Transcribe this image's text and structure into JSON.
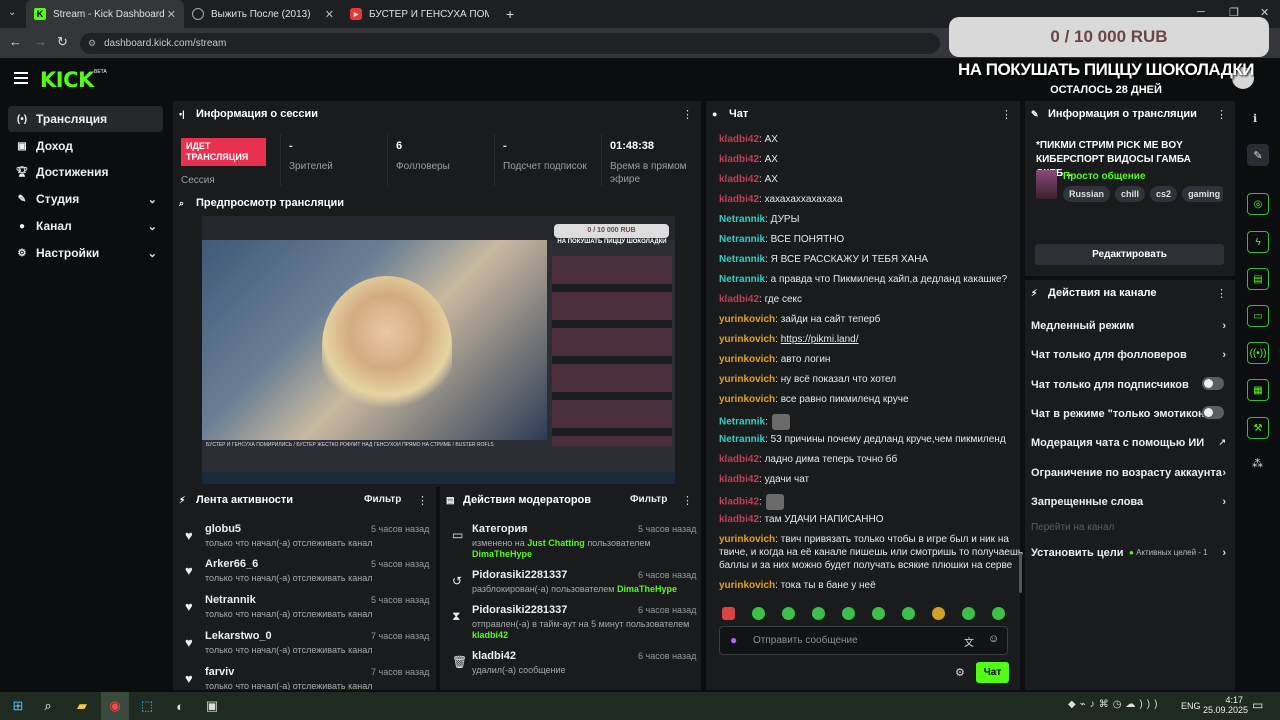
{
  "browser": {
    "tabs": [
      {
        "label": "Stream - Kick Dashboard",
        "active": true
      },
      {
        "label": "Выжить После (2013)",
        "active": false
      },
      {
        "label": "БУСТЕР И ГЕНСУХА ПОМИРИЛ...",
        "active": false
      }
    ],
    "new_tab": "+",
    "url": "dashboard.kick.com/stream"
  },
  "overlay": {
    "goal": "0 / 10 000 RUB",
    "title": "НА ПОКУШАТЬ ПИЦЦУ ШОКОЛАДКИ",
    "subtitle": "ОСТАЛОСЬ 28 ДНЕЙ"
  },
  "header": {
    "logo": "KICK",
    "beta": "BETA"
  },
  "sidebar": {
    "items": [
      {
        "label": "Трансляция",
        "icon": "broadcast-icon"
      },
      {
        "label": "Доход",
        "icon": "wallet-icon"
      },
      {
        "label": "Достижения",
        "icon": "trophy-icon"
      },
      {
        "label": "Студия",
        "icon": "brush-icon"
      },
      {
        "label": "Канал",
        "icon": "person-icon"
      },
      {
        "label": "Настройки",
        "icon": "gear-icon"
      }
    ]
  },
  "session": {
    "title": "Информация о сессии",
    "live_badge": "ИДЕТ ТРАНСЛЯЦИЯ",
    "session_label": "Сессия",
    "stats": [
      {
        "value": "-",
        "label": "Зрителей"
      },
      {
        "value": "6",
        "label": "Фолловеры"
      },
      {
        "value": "-",
        "label": "Подсчет подписок"
      },
      {
        "value": "01:48:38",
        "label": "Время в прямом эфире"
      }
    ]
  },
  "preview": {
    "title": "Предпросмотр трансляции",
    "inner_goal": "0 / 10 000 RUB",
    "inner_title": "НА ПОКУШАТЬ ПИЦЦУ ШОКОЛАДКИ",
    "inner_video_title": "БУСТЕР И ГЕНСУХА ПОМИРИЛИСЬ / БУСТЕР ЖЕСТКО РОФЛИТ НАД ГЕНСУХОЙ ПРЯМО НА СТРИМЕ / BUSTER ROFLS"
  },
  "activity": {
    "title": "Лента активности",
    "filter": "Фильтр",
    "items": [
      {
        "name": "globu5",
        "text": "только что начал(-а) отслеживать канал",
        "time": "5 часов назад"
      },
      {
        "name": "Arker66_6",
        "text": "только что начал(-а) отслеживать канал",
        "time": "5 часов назад"
      },
      {
        "name": "Netrannik",
        "text": "только что начал(-а) отслеживать канал",
        "time": "5 часов назад"
      },
      {
        "name": "Lekarstwo_0",
        "text": "только что начал(-а) отслеживать канал",
        "time": "7 часов назад"
      },
      {
        "name": "farviv",
        "text": "только что начал(-а) отслеживать канал",
        "time": "7 часов назад"
      }
    ]
  },
  "modactions": {
    "title": "Действия модераторов",
    "filter": "Фильтр",
    "items": [
      {
        "name": "Категория",
        "line1": "изменено на",
        "hl1": "Just Chatting",
        "line1b": "пользователем",
        "hl2": "DimaTheHype",
        "time": "5 часов назад",
        "icon": "category-icon"
      },
      {
        "name": "Pidorasiki2281337",
        "line1": "разблокирован(-а) пользователем",
        "hl1": "DimaTheHype",
        "time": "6 часов назад",
        "icon": "unban-icon"
      },
      {
        "name": "Pidorasiki2281337",
        "line1": "отправлен(-а) в тайм-аут на 5 минут пользователем",
        "hl1": "kladbi42",
        "time": "6 часов назад",
        "icon": "hourglass-icon"
      },
      {
        "name": "kladbi42",
        "line1": "удалил(-а) сообщение",
        "time": "6 часов назад",
        "icon": "trash-icon"
      }
    ]
  },
  "chat": {
    "title": "Чат",
    "messages": [
      {
        "user": "kladbi42",
        "color": "red",
        "text": ": АХ"
      },
      {
        "user": "kladbi42",
        "color": "red",
        "text": ": АХ"
      },
      {
        "user": "kladbi42",
        "color": "red",
        "text": ": АХ"
      },
      {
        "user": "kladbi42",
        "color": "red",
        "text": ": хахахаххахахаха"
      },
      {
        "user": "Netrannik",
        "color": "teal",
        "text": ": ДУРЫ"
      },
      {
        "user": "Netrannik",
        "color": "teal",
        "text": ": ВСЕ ПОНЯТНО"
      },
      {
        "user": "Netrannik",
        "color": "teal",
        "text": ": Я ВСЕ РАССКАЖУ И ТЕБЯ ХАНА"
      },
      {
        "user": "Netrannik",
        "color": "teal",
        "text": ": а правда что Пикмиленд хайп,а дедланд какашке?"
      },
      {
        "user": "kladbi42",
        "color": "red",
        "text": ": где секс"
      },
      {
        "user": "yurinkovich",
        "color": "gold",
        "text": ": зайди на сайт теперб"
      },
      {
        "user": "yurinkovich",
        "color": "gold",
        "text": ": ",
        "link": "https://pikmi.land/"
      },
      {
        "user": "yurinkovich",
        "color": "gold",
        "text": ": авто логин"
      },
      {
        "user": "yurinkovich",
        "color": "gold",
        "text": ": ну всё показал что хотел"
      },
      {
        "user": "yurinkovich",
        "color": "gold",
        "text": ": все равно пикмиленд круче"
      },
      {
        "user": "Netrannik",
        "color": "teal",
        "text": ":",
        "emote": true
      },
      {
        "user": "Netrannik",
        "color": "teal",
        "text": ": 53 причины почему дедланд круче,чем пикмиленд"
      },
      {
        "user": "kladbi42",
        "color": "red",
        "text": ": ладно дима теперь точно бб"
      },
      {
        "user": "kladbi42",
        "color": "red",
        "text": ": удачи чат"
      },
      {
        "user": "kladbi42",
        "color": "red",
        "text": ":",
        "emote": true
      },
      {
        "user": "kladbi42",
        "color": "red",
        "text": ": там УДАЧИ НАПИСАННО"
      },
      {
        "user": "yurinkovich",
        "color": "gold",
        "text": ": твич привязать только чтобы в игре был и ник на",
        "cont": [
          "твиче, и когда на её канале пишешь или смотришь то получаешь",
          "баллы и за них можно будет получать всякие плюшки на серве"
        ]
      },
      {
        "user": "yurinkovich",
        "color": "gold",
        "text": ": тока ты в бане у неё"
      }
    ],
    "input_placeholder": "Отправить сообщение",
    "send": "Чат"
  },
  "stream_info": {
    "title": "Информация о трансляции",
    "stream_title": "*ПИКМИ СТРИМ PICK ME BOY КИБЕРСПОРТ ВИДОСЫ ГАМБА СКЕБ...",
    "category": "Просто общение",
    "tags": [
      "Russian",
      "chill",
      "cs2",
      "gaming"
    ],
    "edit": "Редактировать"
  },
  "channel_actions": {
    "title": "Действия на канале",
    "items": [
      {
        "label": "Медленный режим",
        "kind": "chevron"
      },
      {
        "label": "Чат только для фолловеров",
        "kind": "chevron"
      },
      {
        "label": "Чат только для подписчиков",
        "kind": "toggle"
      },
      {
        "label": "Чат в режиме \"только эмотиконы\"",
        "kind": "toggle"
      },
      {
        "label": "Модерация чата с помощью ИИ",
        "kind": "external"
      },
      {
        "label": "Ограничение по возрасту аккаунта",
        "kind": "chevron"
      },
      {
        "label": "Запрещенные слова",
        "kind": "chevron"
      }
    ],
    "goto_channel": "Перейти на канал",
    "set_goals": "Установить цели",
    "active_goals": "Активных целей - 1"
  },
  "taskbar": {
    "lang": "ENG",
    "time": "4:17",
    "date": "25.09.2025"
  },
  "colors": {
    "accent": "#53fc18",
    "live": "#e8304f"
  }
}
